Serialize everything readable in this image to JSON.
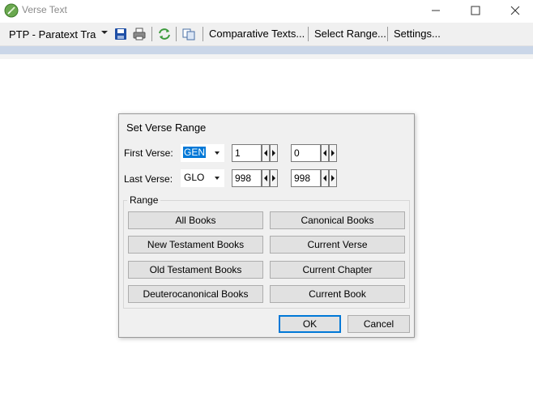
{
  "window": {
    "title": "Verse Text",
    "icons": [
      "app-icon",
      "minimize-icon",
      "maximize-icon",
      "close-icon"
    ]
  },
  "toolbar": {
    "project": "PTP - Paratext Trai",
    "icons": [
      "save-icon",
      "print-icon",
      "refresh-icon",
      "copy-icon"
    ],
    "comparative_texts": "Comparative Texts...",
    "select_range": "Select Range...",
    "settings": "Settings..."
  },
  "colors": {
    "accent": "#0078d7",
    "toolbar_band": "#cad6e8",
    "dialog_bg": "#f0f0f0",
    "button_bg": "#e1e1e1"
  },
  "dialog": {
    "title": "Set Verse Range",
    "first_verse": {
      "label": "First Verse:",
      "book": "GEN",
      "chapter": "1",
      "verse": "0"
    },
    "last_verse": {
      "label": "Last Verse:",
      "book": "GLO",
      "chapter": "998",
      "verse": "998"
    },
    "range": {
      "legend": "Range",
      "all_books": "All Books",
      "canonical_books": "Canonical Books",
      "new_testament_books": "New Testament Books",
      "current_verse": "Current Verse",
      "old_testament_books": "Old Testament Books",
      "current_chapter": "Current Chapter",
      "deuterocanonical_books": "Deuterocanonical Books",
      "current_book": "Current Book"
    },
    "ok": "OK",
    "cancel": "Cancel"
  }
}
